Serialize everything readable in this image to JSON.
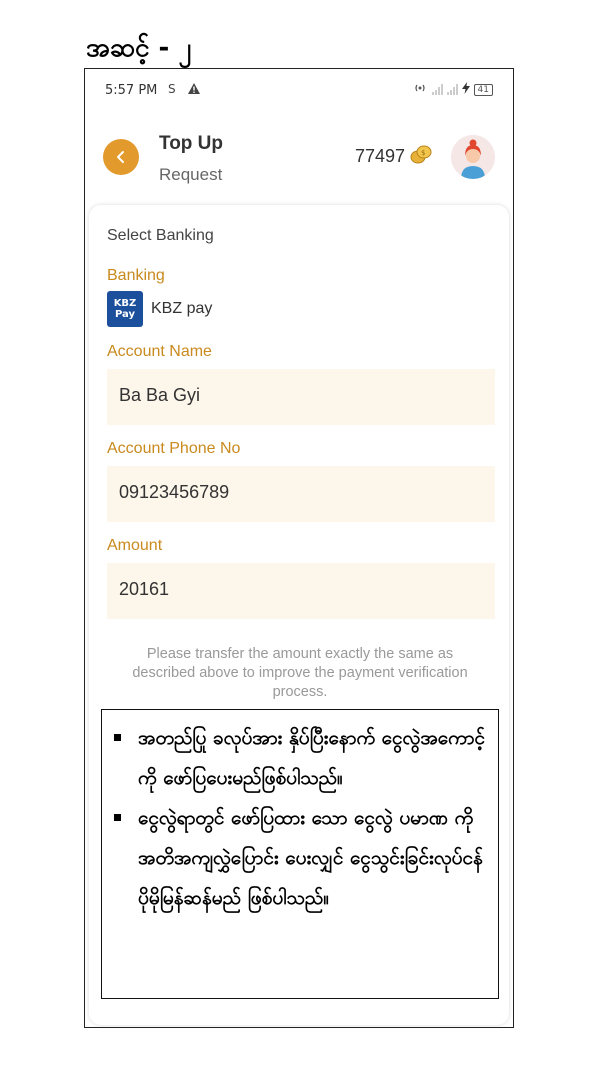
{
  "step_title": "အဆင့် - ၂",
  "status_bar": {
    "time": "5:57 PM",
    "battery": "41"
  },
  "header": {
    "title": "Top Up",
    "subtitle": "Request",
    "coins": "77497"
  },
  "form": {
    "section_title": "Select Banking",
    "banking_label": "Banking",
    "bank_logo_text": "KBZ Pay",
    "bank_name": "KBZ pay",
    "account_name_label": "Account Name",
    "account_name_value": "Ba Ba Gyi",
    "account_phone_label": "Account Phone No",
    "account_phone_value": "09123456789",
    "amount_label": "Amount",
    "amount_value": "20161",
    "note": "Please transfer the amount exactly the same as described above to improve the payment verification process."
  },
  "instructions": [
    "အတည်ပြု ခလုပ်အား နှိပ်ပြီးနောက် ငွေလွဲအကောင့်ကို ဖော်ပြပေးမည်ဖြစ်ပါသည်။",
    "ငွေလွဲရာတွင် ဖော်ပြထား သော ငွေလွဲ ပမာဏ ကို အတိအကျလွှဲပြောင်း ပေးလျှင် ငွေသွင်းခြင်းလုပ်ငန် ပိုမိုမြန်ဆန်မည် ဖြစ်ပါသည်။"
  ],
  "colors": {
    "accent": "#e19a2b",
    "label": "#c98a1e",
    "field_bg": "#fdf6ea",
    "kbz_blue": "#1c4f9c"
  }
}
